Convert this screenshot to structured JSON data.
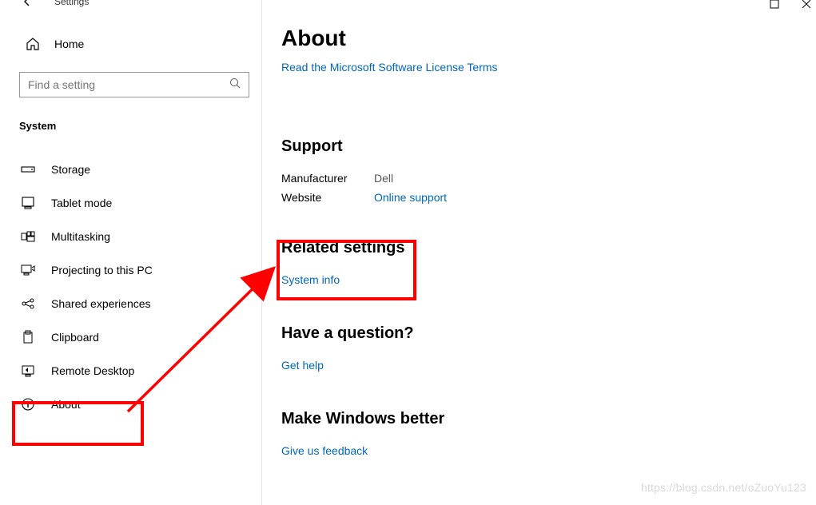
{
  "titlebar": {
    "title": "Settings"
  },
  "sidebar": {
    "home_label": "Home",
    "search_placeholder": "Find a setting",
    "category": "System",
    "items": [
      {
        "icon": "storage-icon",
        "label": "Storage"
      },
      {
        "icon": "tablet-icon",
        "label": "Tablet mode"
      },
      {
        "icon": "multitask-icon",
        "label": "Multitasking"
      },
      {
        "icon": "project-icon",
        "label": "Projecting to this PC"
      },
      {
        "icon": "shared-icon",
        "label": "Shared experiences"
      },
      {
        "icon": "clipboard-icon",
        "label": "Clipboard"
      },
      {
        "icon": "remote-icon",
        "label": "Remote Desktop"
      },
      {
        "icon": "about-icon",
        "label": "About"
      }
    ]
  },
  "main": {
    "title": "About",
    "license_link": "Read the Microsoft Software License Terms",
    "support": {
      "heading": "Support",
      "manufacturer_label": "Manufacturer",
      "manufacturer_value": "Dell",
      "website_label": "Website",
      "website_value": "Online support"
    },
    "related": {
      "heading": "Related settings",
      "link": "System info"
    },
    "question": {
      "heading": "Have a question?",
      "link": "Get help"
    },
    "feedback": {
      "heading": "Make Windows better",
      "link": "Give us feedback"
    }
  },
  "watermark": "https://blog.csdn.net/oZuoYu123"
}
